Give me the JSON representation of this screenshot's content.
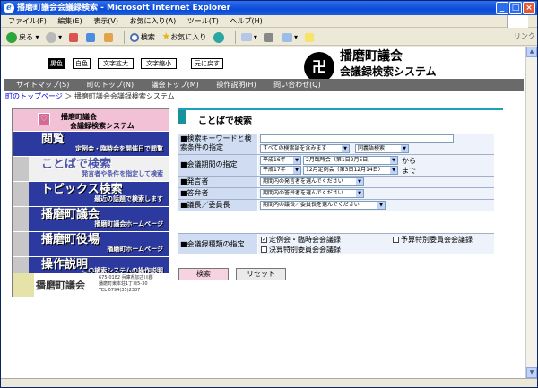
{
  "window": {
    "title": "播磨町議会会議録検索 - Microsoft Internet Explorer",
    "buttons": {
      "minimize": "_",
      "maximize": "□",
      "close": "×"
    }
  },
  "menu": [
    "ファイル(F)",
    "編集(E)",
    "表示(V)",
    "お気に入り(A)",
    "ツール(T)",
    "ヘルプ(H)"
  ],
  "toolbar": {
    "back": "戻る",
    "search": "検索",
    "favorites": "お気に入り",
    "links": "リンク"
  },
  "display_controls": [
    "黒色",
    "白色",
    "文字拡大",
    "文字縮小",
    "元に戻す"
  ],
  "logo": {
    "emblem": "卍",
    "name": "播磨町議会",
    "subtitle": "会議録検索システム"
  },
  "global_nav": [
    "サイトマップ(S)",
    "町のトップ(N)",
    "議会トップ(M)",
    "操作説明(H)",
    "問い合わせ(Q)"
  ],
  "breadcrumb": {
    "home": "町のトップページ",
    "sep": "＞",
    "current": "播磨町議会会議録検索システム"
  },
  "sidebar": {
    "top": {
      "line1": "播磨町議会",
      "line2": "会議録検索システム"
    },
    "items": [
      {
        "title": "閲覧",
        "desc": "定例会・臨時会を開催日で閲覧"
      },
      {
        "title": "ことばで検索",
        "desc": "発言者や条件を指定して検索"
      },
      {
        "title": "トピックス検索",
        "desc": "最近の話題で検索します"
      },
      {
        "title": "播磨町議会",
        "desc": "播磨町議会ホームページ"
      },
      {
        "title": "播磨町役場",
        "desc": "播磨町ホームページ"
      },
      {
        "title": "操作説明",
        "desc": "この検索システムの操作説明"
      }
    ],
    "footer": {
      "name": "播磨町議会",
      "address1": "675-0182 兵庫県加古川郡",
      "address2": "播磨町東本荘1丁目5-30",
      "tel": "TEL 0794(35)2387"
    }
  },
  "form": {
    "heading": "ことばで検索",
    "keyword": {
      "label": "■検索キーワードと検索条件の指定",
      "mode": "すべての検索語を含みます",
      "synonym": "同義語検索"
    },
    "period": {
      "label": "■会議期間の指定",
      "from_year": "平成16年",
      "from_session": "2月臨時会（第1日2月5日）",
      "from_suffix": "から",
      "to_year": "平成17年",
      "to_session": "12月定例会（第3日12月14日）",
      "to_suffix": "まで"
    },
    "speaker": {
      "label": "■発言者",
      "placeholder": "期間内の発言者を選んでください"
    },
    "respondent": {
      "label": "■答弁者",
      "placeholder": "期間内の答弁者を選んでください"
    },
    "chair": {
      "label": "■議長／委員長",
      "placeholder": "期間内の議長／委員長を選んでください"
    },
    "type": {
      "label": "■会議録種類の指定",
      "options": [
        {
          "label": "定例会・臨時会会議録",
          "checked": true
        },
        {
          "label": "予算特別委員会会議録",
          "checked": false
        },
        {
          "label": "決算特別委員会会議録",
          "checked": false
        }
      ]
    },
    "search_button": "検索",
    "reset_button": "リセット"
  },
  "colors": {
    "nav_blue": "#2c3aa0",
    "accent_teal": "#17919a",
    "label_bg": "#cfdcf1",
    "pink": "#f3c1d6"
  }
}
